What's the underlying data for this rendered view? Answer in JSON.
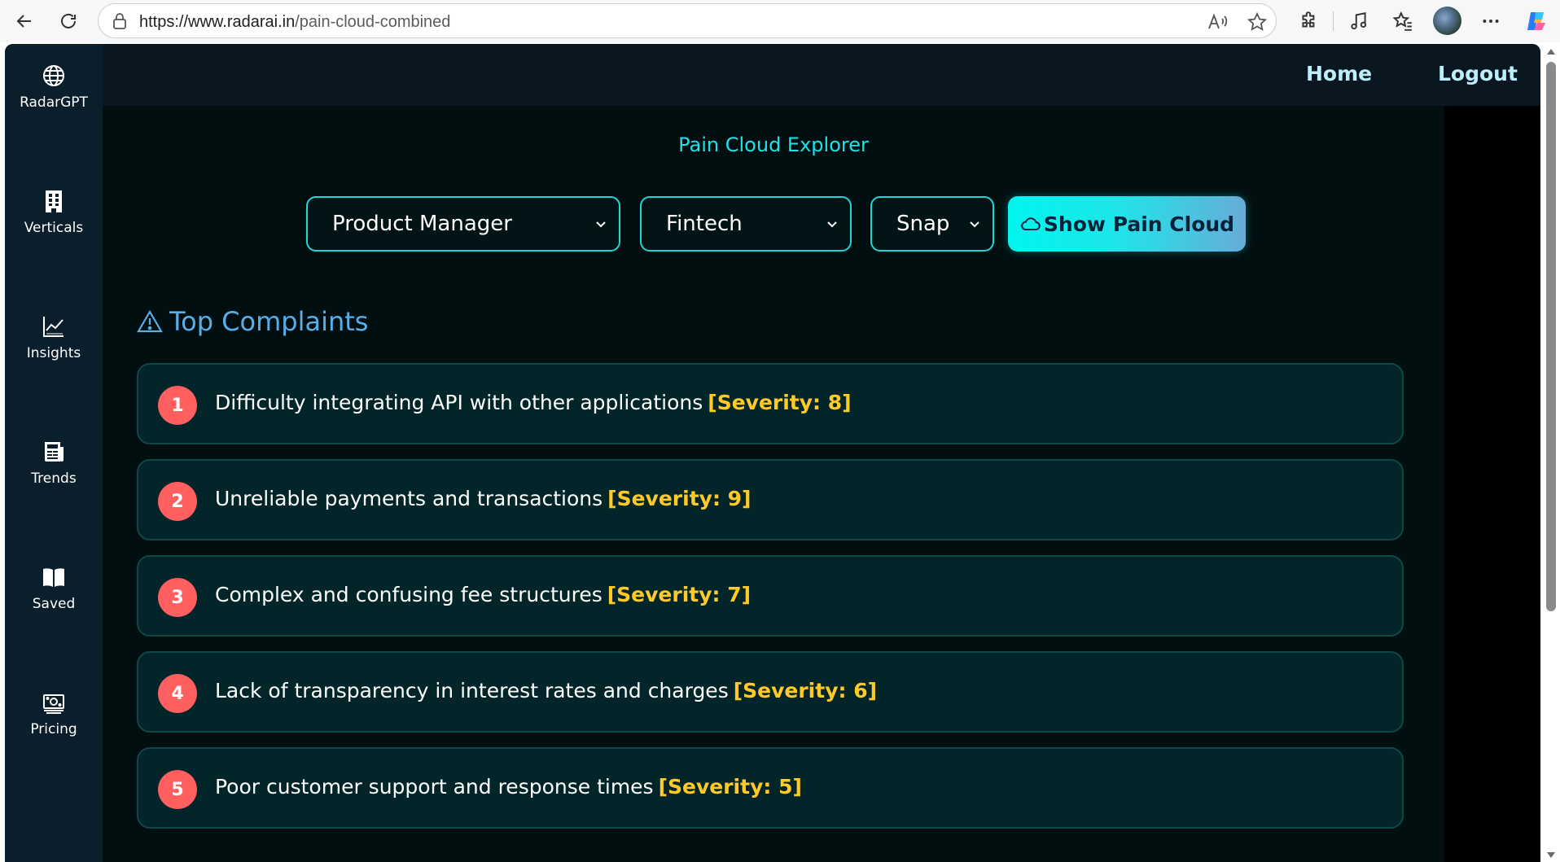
{
  "browser": {
    "url_host": "https://www.radarai.in",
    "url_path": "/pain-cloud-combined"
  },
  "sidebar": {
    "items": [
      {
        "label": "RadarGPT",
        "icon": "globe-icon"
      },
      {
        "label": "Verticals",
        "icon": "building-icon"
      },
      {
        "label": "Insights",
        "icon": "chart-line-icon"
      },
      {
        "label": "Trends",
        "icon": "newspaper-icon"
      },
      {
        "label": "Saved",
        "icon": "book-icon"
      },
      {
        "label": "Pricing",
        "icon": "money-icon"
      }
    ]
  },
  "header": {
    "home": "Home",
    "logout": "Logout"
  },
  "page": {
    "title": "Pain Cloud Explorer"
  },
  "filters": {
    "role": "Product Manager",
    "vertical": "Fintech",
    "company": "Snap",
    "show_button": "Show Pain Cloud"
  },
  "complaints_section": {
    "title": "Top Complaints",
    "items": [
      {
        "rank": "1",
        "text": "Difficulty integrating API with other applications",
        "severity": "[Severity: 8]"
      },
      {
        "rank": "2",
        "text": "Unreliable payments and transactions",
        "severity": "[Severity: 9]"
      },
      {
        "rank": "3",
        "text": "Complex and confusing fee structures",
        "severity": "[Severity: 7]"
      },
      {
        "rank": "4",
        "text": "Lack of transparency in interest rates and charges",
        "severity": "[Severity: 6]"
      },
      {
        "rank": "5",
        "text": "Poor customer support and response times",
        "severity": "[Severity: 5]"
      }
    ]
  },
  "colors": {
    "accent": "#20e0e8",
    "severity": "#ffc928",
    "rank_badge": "#ff5f5f",
    "section_title": "#5aaee8"
  }
}
